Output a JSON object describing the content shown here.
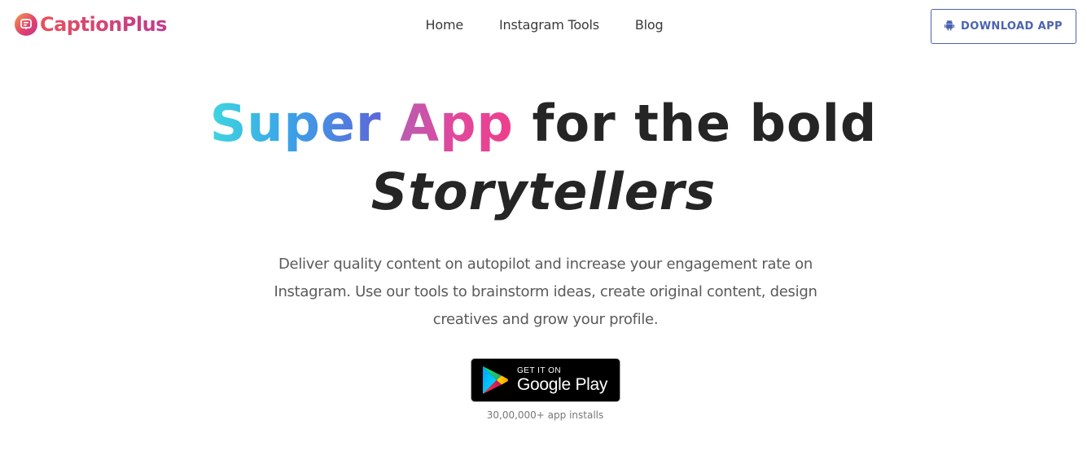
{
  "brand": {
    "name": "CaptionPlus",
    "icon": "instagram-caption-icon",
    "gradient": [
      "#f0a04b",
      "#e2436b",
      "#c2338d"
    ]
  },
  "nav": {
    "items": [
      {
        "label": "Home"
      },
      {
        "label": "Instagram Tools"
      },
      {
        "label": "Blog"
      }
    ]
  },
  "download": {
    "label": "DOWNLOAD APP",
    "icon": "android-icon",
    "color": "#4b63b0"
  },
  "hero": {
    "word_super": "Super",
    "word_app": "App",
    "rest_line1": "for the bold",
    "line2": "Storytellers",
    "subtitle_lines": [
      "Deliver quality content on autopilot and increase your engagement rate on",
      "Instagram. Use our tools to brainstorm ideas, create original content, design",
      "creatives and grow your profile."
    ]
  },
  "store_badge": {
    "small": "GET IT ON",
    "big": "Google Play",
    "icon": "google-play-icon"
  },
  "installs": "30,00,000+ app installs"
}
